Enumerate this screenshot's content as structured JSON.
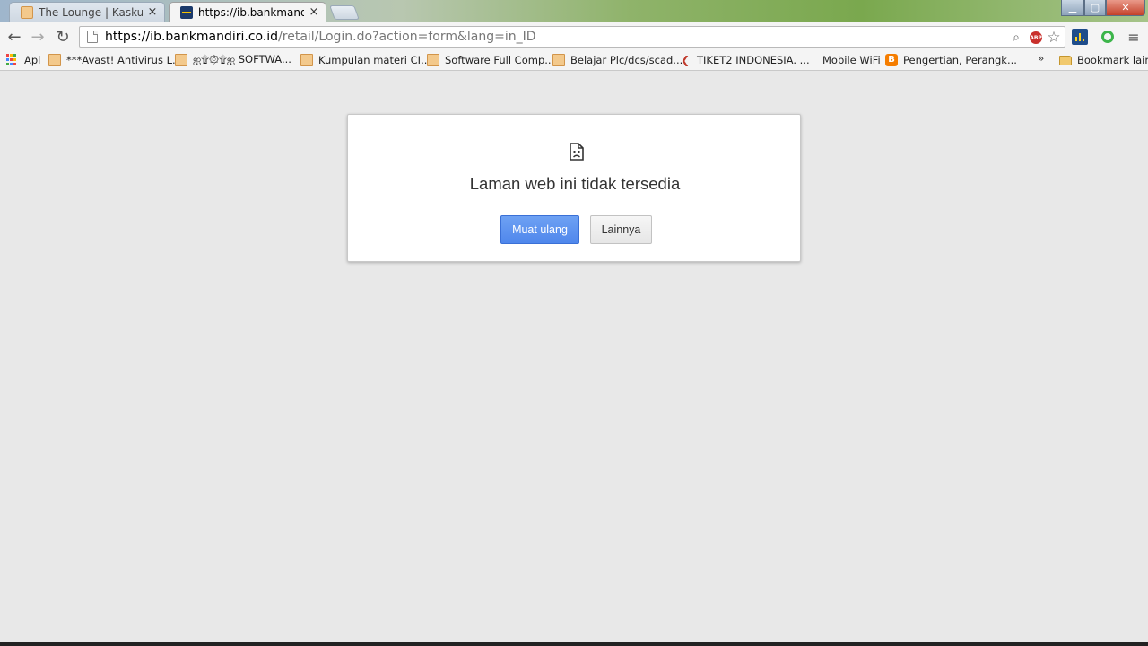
{
  "tabs": [
    {
      "title": "The Lounge | Kaskus - The",
      "close": "×",
      "active": false
    },
    {
      "title": "https://ib.bankmandiri.co",
      "close": "×",
      "active": true
    }
  ],
  "window_controls": {
    "minimize": "▁",
    "maximize": "▢",
    "close": "✕"
  },
  "toolbar": {
    "back_icon": "←",
    "forward_icon": "→",
    "reload_icon": "↻",
    "url_host": "https://ib.bankmandiri.co.id",
    "url_path": "/retail/Login.do?action=form&lang=in_ID",
    "search_icon": "⌕",
    "adblock_label": "ABP",
    "star_icon": "☆",
    "menu_icon": "≡"
  },
  "bookmarks": [
    {
      "label": "Apl",
      "icon": "apps"
    },
    {
      "label": "***Avast! Antivirus L...",
      "icon": "page"
    },
    {
      "label": "ஐ۩۞۩ஐ SOFTWA...",
      "icon": "page"
    },
    {
      "label": "Kumpulan materi CI...",
      "icon": "page"
    },
    {
      "label": "Software Full Comp...",
      "icon": "page"
    },
    {
      "label": "Belajar Plc/dcs/scad...",
      "icon": "page"
    },
    {
      "label": "TIKET2 INDONESIA. ...",
      "icon": "tiket"
    },
    {
      "label": "Mobile WiFi",
      "icon": "none"
    },
    {
      "label": "Pengertian, Perangk...",
      "icon": "blogger"
    },
    {
      "label": "Bookmark lain",
      "icon": "folder"
    }
  ],
  "bookmarks_more": "»",
  "error": {
    "title": "Laman web ini tidak tersedia",
    "reload_label": "Muat ulang",
    "more_label": "Lainnya"
  },
  "colors": {
    "primary_button": "#4f87ec",
    "page_background": "#e8e8e8"
  }
}
